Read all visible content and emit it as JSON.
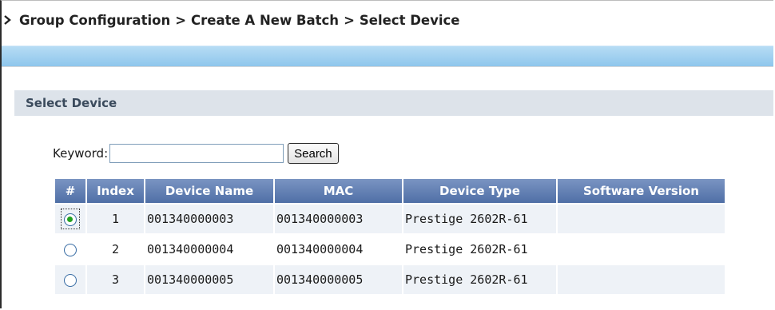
{
  "breadcrumb": {
    "items": [
      "Group Configuration",
      "Create A New Batch",
      "Select Device"
    ],
    "separator": ">"
  },
  "section": {
    "title": "Select Device"
  },
  "search": {
    "label": "Keyword:",
    "value": "",
    "button_label": "Search"
  },
  "table": {
    "headers": [
      "#",
      "Index",
      "Device Name",
      "MAC",
      "Device Type",
      "Software Version"
    ],
    "rows": [
      {
        "selected": true,
        "index": "1",
        "device_name": "001340000003",
        "mac": "001340000003",
        "device_type": "Prestige 2602R-61",
        "software_version": ""
      },
      {
        "selected": false,
        "index": "2",
        "device_name": "001340000004",
        "mac": "001340000004",
        "device_type": "Prestige 2602R-61",
        "software_version": ""
      },
      {
        "selected": false,
        "index": "3",
        "device_name": "001340000005",
        "mac": "001340000005",
        "device_type": "Prestige 2602R-61",
        "software_version": ""
      }
    ]
  },
  "colors": {
    "header_bg": "#5f7fb3",
    "bar_blue": "#9fcff0",
    "section_bg": "#dde3ea",
    "radio_dot": "#21a121"
  }
}
